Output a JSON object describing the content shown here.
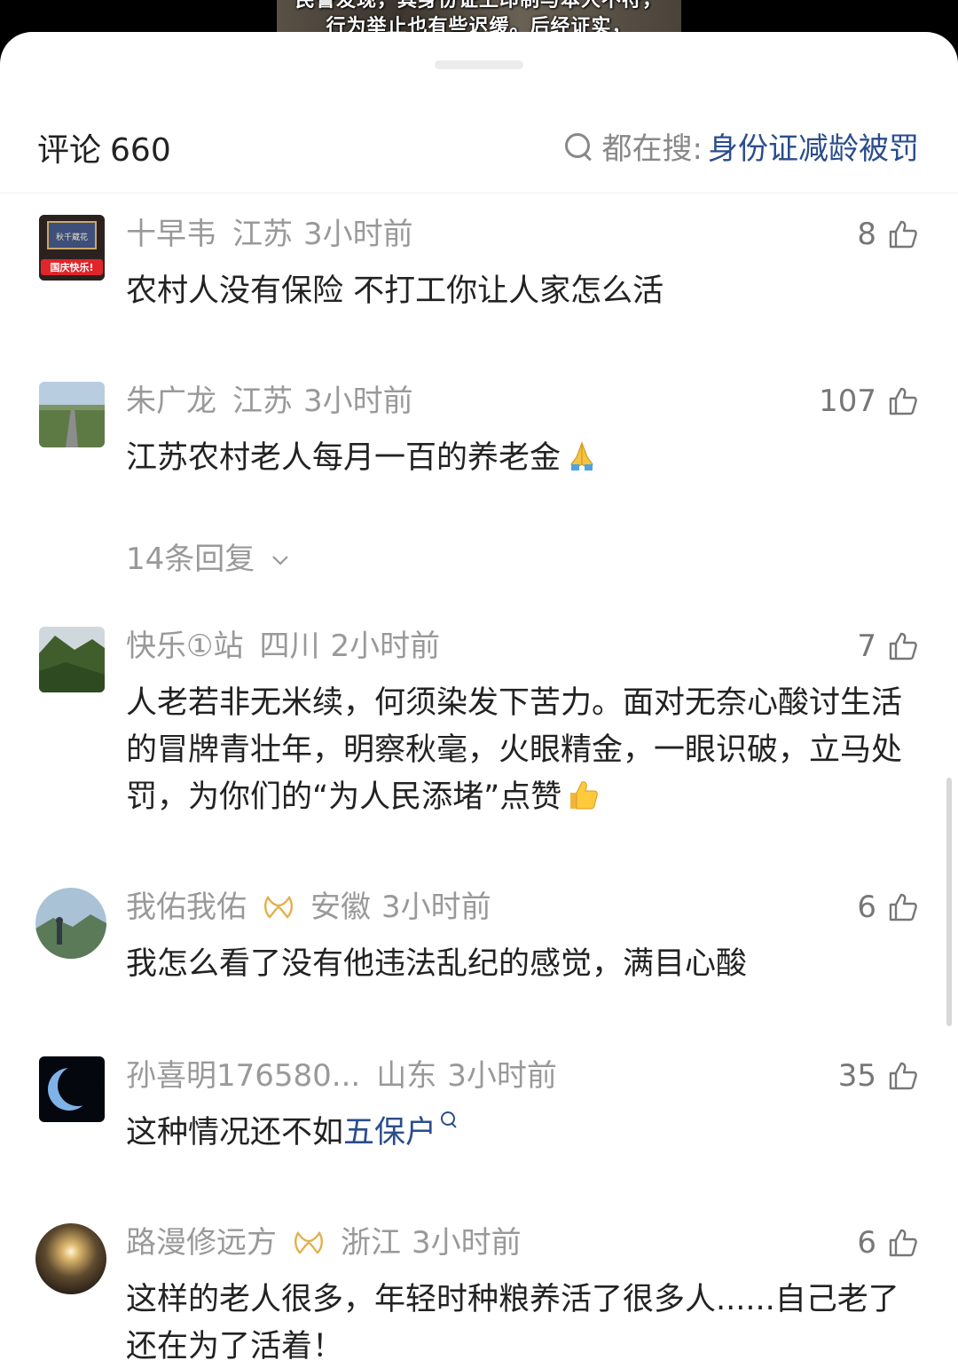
{
  "video": {
    "caption_line1": "民警发现，其身份证上印制与本人不符，",
    "caption_line2": "行为举止也有些迟缓。后经证实，"
  },
  "header": {
    "title": "评论",
    "count": "660",
    "search_prefix": "都在搜:",
    "search_term": "身份证减龄被罚"
  },
  "comments": [
    {
      "user": "十早韦",
      "location": "江苏",
      "time": "3小时前",
      "likes": "8",
      "text": "农村人没有保险 不打工你让人家怎么活",
      "avatar_sign": "秋千蔵花",
      "avatar_tag": "国庆快乐!"
    },
    {
      "user": "朱广龙",
      "location": "江苏",
      "time": "3小时前",
      "likes": "107",
      "text": "江苏农村老人每月一百的养老金",
      "replies": "14条回复"
    },
    {
      "user": "快乐①站",
      "location": "四川",
      "time": "2小时前",
      "likes": "7",
      "text": "人老若非无米续，何须染发下苦力。面对无奈心酸讨生活的冒牌青壮年，明察秋毫，火眼精金，一眼识破，立马处罚，为你们的“为人民添堵”点赞"
    },
    {
      "user": "我佑我佑",
      "location": "安徽",
      "time": "3小时前",
      "likes": "6",
      "text": "我怎么看了没有他违法乱纪的感觉，满目心酸"
    },
    {
      "user": "孙喜明176580...",
      "location": "山东",
      "time": "3小时前",
      "likes": "35",
      "text_before": "这种情况还不如",
      "keyword": "五保户"
    },
    {
      "user": "路漫修远方",
      "location": "浙江",
      "time": "3小时前",
      "likes": "6",
      "text": "这样的老人很多，年轻时种粮养活了很多人......自己老了还在为了活着！"
    }
  ]
}
